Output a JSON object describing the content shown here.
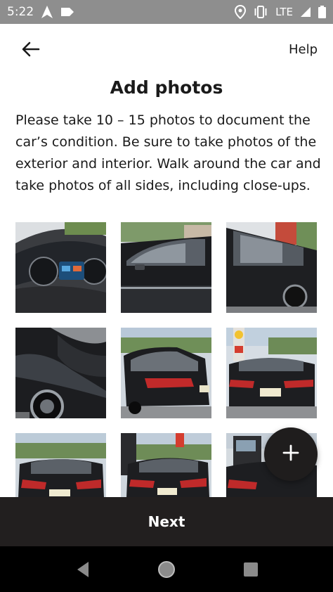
{
  "status_bar": {
    "time": "5:22",
    "network": "LTE",
    "icons": [
      "navigation-arrow-icon",
      "tag-icon",
      "location-pin-icon",
      "vibrate-icon",
      "signal-icon",
      "battery-icon"
    ]
  },
  "header": {
    "back_icon": "arrow-left-icon",
    "help_label": "Help"
  },
  "main": {
    "title": "Add photos",
    "instructions": "Please take 10 – 15 photos to document the car’s condition. Be sure to take photos of the exterior and interior. Walk around the car and take photos of all sides, including close-ups."
  },
  "photos": [
    {
      "subject": "dashboard-interior"
    },
    {
      "subject": "side-window-exterior"
    },
    {
      "subject": "side-rear-door-exterior"
    },
    {
      "subject": "rear-quarter-closeup"
    },
    {
      "subject": "rear-three-quarter"
    },
    {
      "subject": "rear-view"
    },
    {
      "subject": "rear-view-parking-lot"
    },
    {
      "subject": "rear-view-gas-station"
    },
    {
      "subject": "rear-view-pump"
    }
  ],
  "fab": {
    "icon": "plus-icon"
  },
  "footer": {
    "next_label": "Next"
  },
  "colors": {
    "status_bar": "#8e8e8e",
    "primary_dark": "#221f1f",
    "background": "#ffffff"
  }
}
